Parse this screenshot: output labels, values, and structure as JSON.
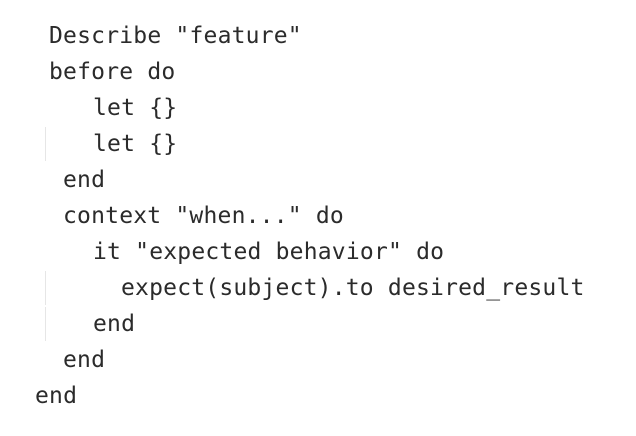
{
  "code": {
    "lines": [
      "Describe \"feature\"",
      "before do",
      "let {}",
      "let {}",
      "end",
      "context \"when...\" do",
      "it \"expected behavior\" do",
      "expect(subject).to desired_result",
      "end",
      "end",
      "end"
    ]
  }
}
